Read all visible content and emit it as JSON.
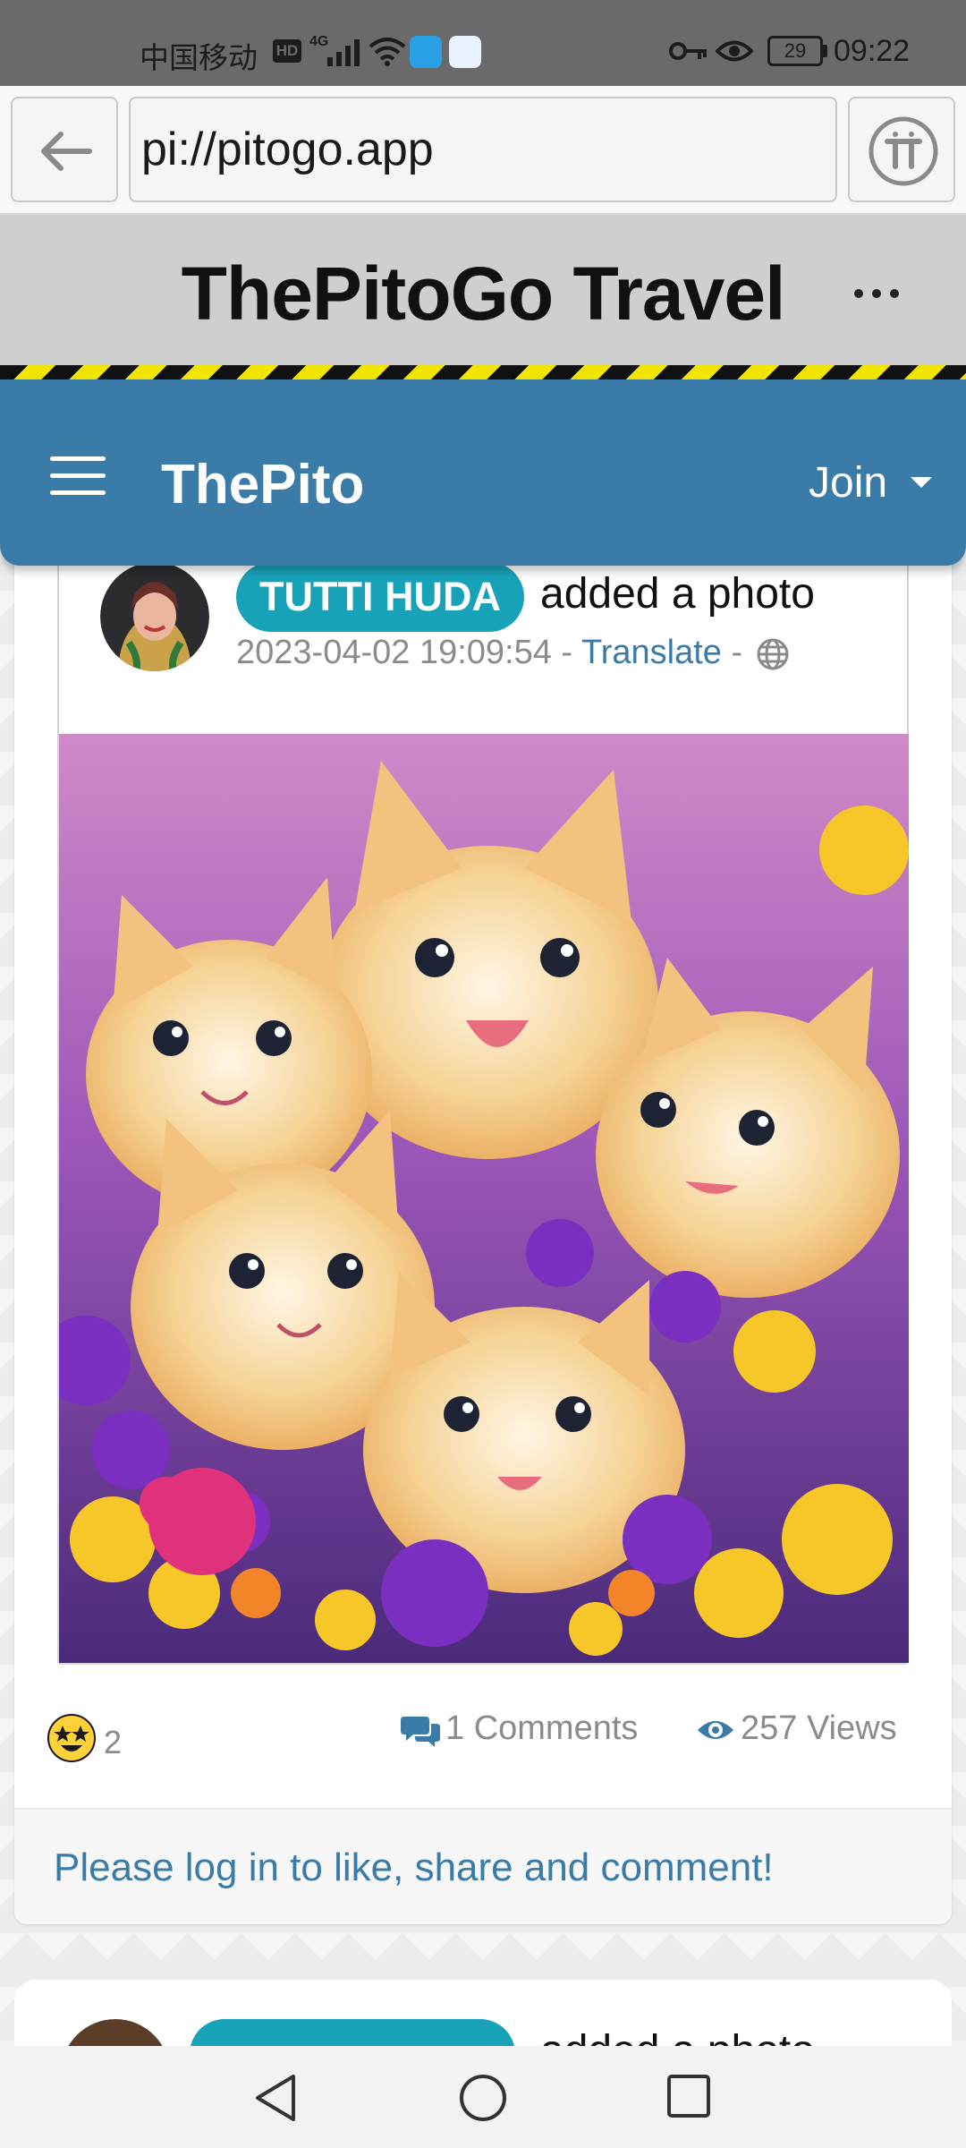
{
  "status_bar": {
    "carrier": "中国移动",
    "hd": "HD",
    "network": "4G",
    "battery": "29",
    "time": "09:22"
  },
  "browser": {
    "address": "pi://pitogo.app",
    "back_icon": "arrow-left-icon",
    "pi_icon": "pi-logo-icon"
  },
  "site": {
    "title": "ThePitoGo Travel",
    "more_icon": "more-horizontal-icon"
  },
  "nav": {
    "brand": "ThePito",
    "join_label": "Join",
    "color": "#3b7ba8"
  },
  "post": {
    "author": "TUTTI HUDA",
    "action": "added a photo",
    "timestamp": "2023-04-02 19:09:54",
    "separator": "-",
    "translate_label": "Translate",
    "privacy_icon": "globe-icon",
    "reaction_count": "2",
    "comments_label": "1 Comments",
    "views_label": "257 Views",
    "login_prompt": "Please log in to like, share and comment!",
    "badge_color": "#17a2b8"
  },
  "next_post": {
    "action": "added a photo"
  }
}
